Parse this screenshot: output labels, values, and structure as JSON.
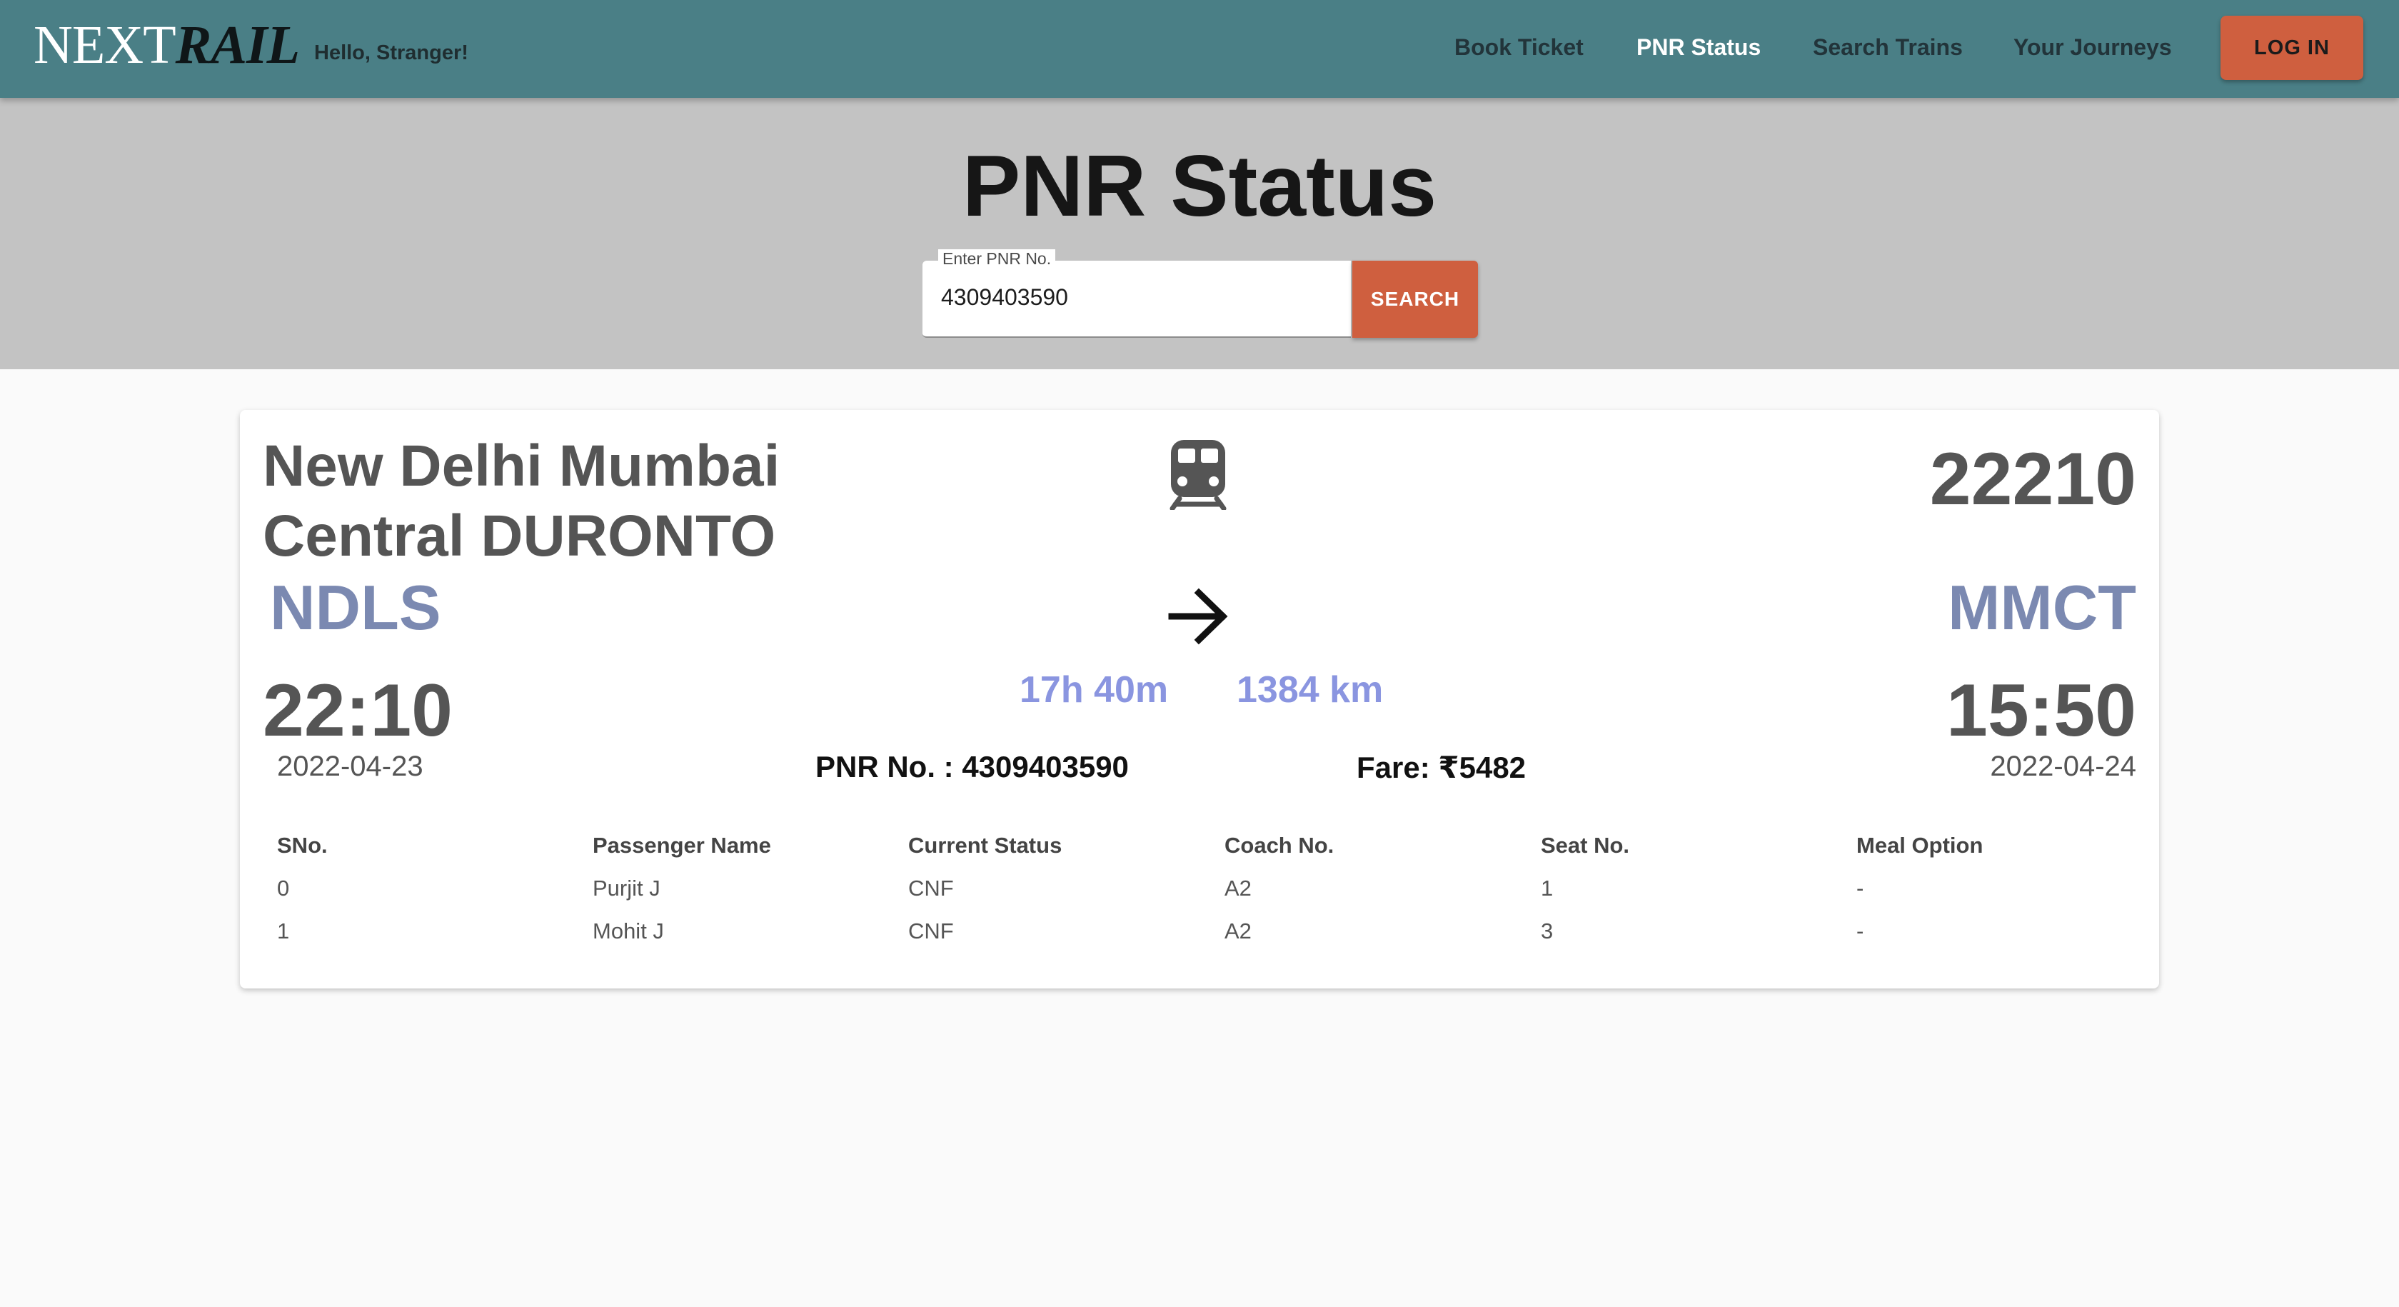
{
  "navbar": {
    "logo_part1": "NEXT",
    "logo_part2": "RAIL",
    "greeting": "Hello, Stranger!",
    "links": [
      "Book Ticket",
      "PNR Status",
      "Search Trains",
      "Your Journeys"
    ],
    "active_link": "PNR Status",
    "login_label": "LOG IN"
  },
  "hero": {
    "title": "PNR Status",
    "pnr_input_label": "Enter PNR No.",
    "pnr_input_value": "4309403590",
    "search_label": "SEARCH"
  },
  "ticket": {
    "train_name": "New Delhi Mumbai Central DURONTO",
    "train_number": "22210",
    "from_code": "NDLS",
    "to_code": "MMCT",
    "departure_time": "22:10",
    "arrival_time": "15:50",
    "duration": "17h 40m",
    "distance": "1384 km",
    "departure_date": "2022-04-23",
    "arrival_date": "2022-04-24",
    "pnr_text": "PNR No. : 4309403590",
    "fare_text": "Fare: ₹5482",
    "icons": {
      "train": "train-icon",
      "arrow": "arrow-right-icon"
    }
  },
  "passengers": {
    "headers": [
      "SNo.",
      "Passenger Name",
      "Current Status",
      "Coach No.",
      "Seat No.",
      "Meal Option"
    ],
    "rows": [
      [
        "0",
        "Purjit J",
        "CNF",
        "A2",
        "1",
        "-"
      ],
      [
        "1",
        "Mohit J",
        "CNF",
        "A2",
        "3",
        "-"
      ]
    ]
  },
  "colors": {
    "navbar": "#4a7f86",
    "hero": "#c3c3c3",
    "accent_button": "#cf5f3f",
    "station_code": "#7b89b1",
    "duration_distance": "#8a95e0"
  }
}
